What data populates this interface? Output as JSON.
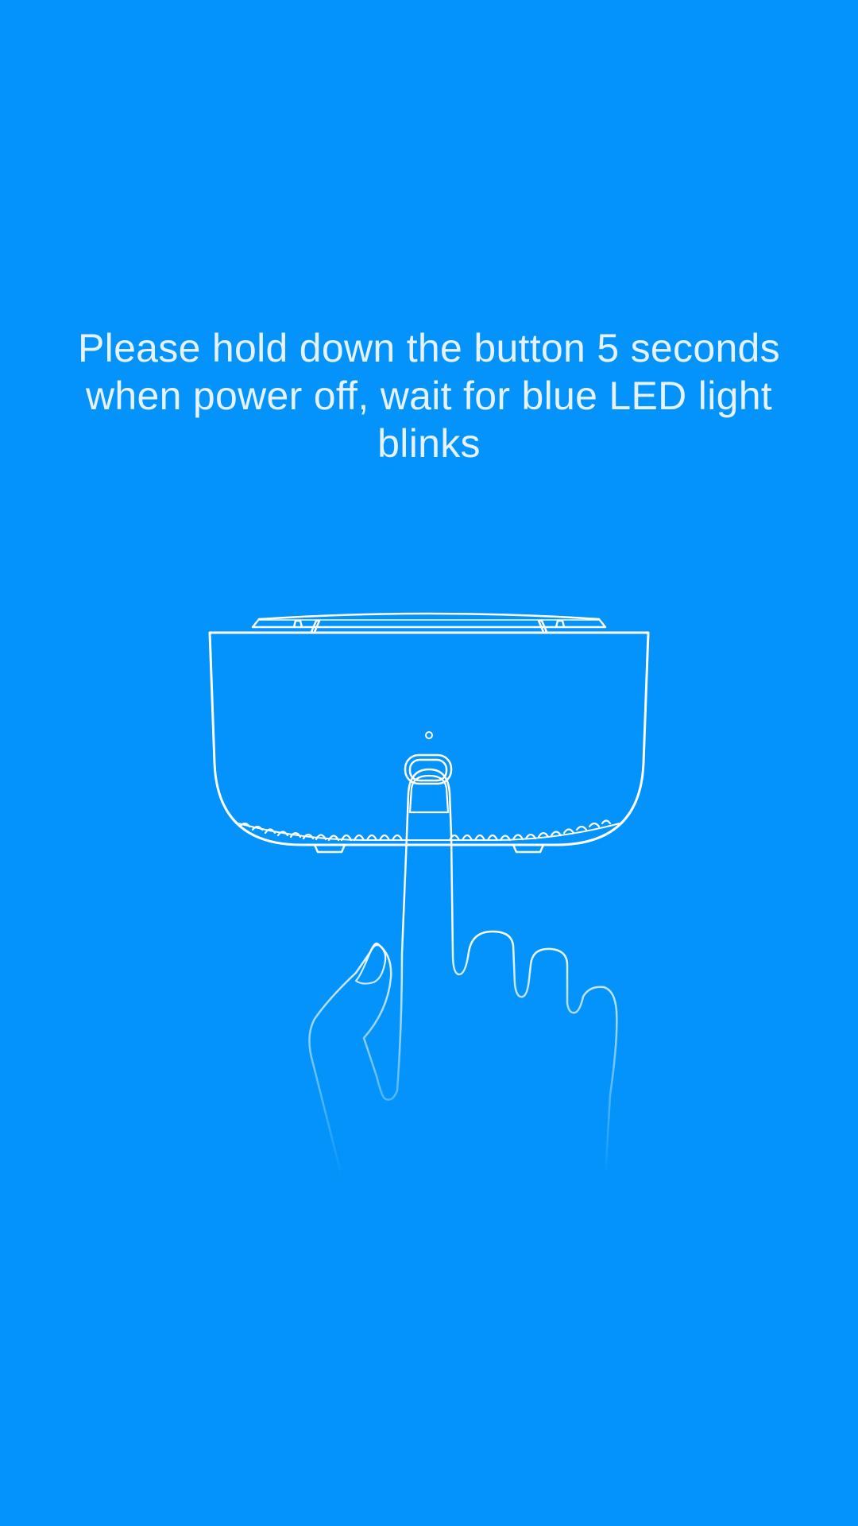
{
  "instruction": {
    "text": "Please hold down the button 5 seconds when power off, wait for blue LED light blinks"
  },
  "illustration": {
    "icon": "hand-pressing-device-button-icon"
  },
  "colors": {
    "background": "#0393fb",
    "text": "#e6f2ff",
    "line": "#ffffff"
  }
}
